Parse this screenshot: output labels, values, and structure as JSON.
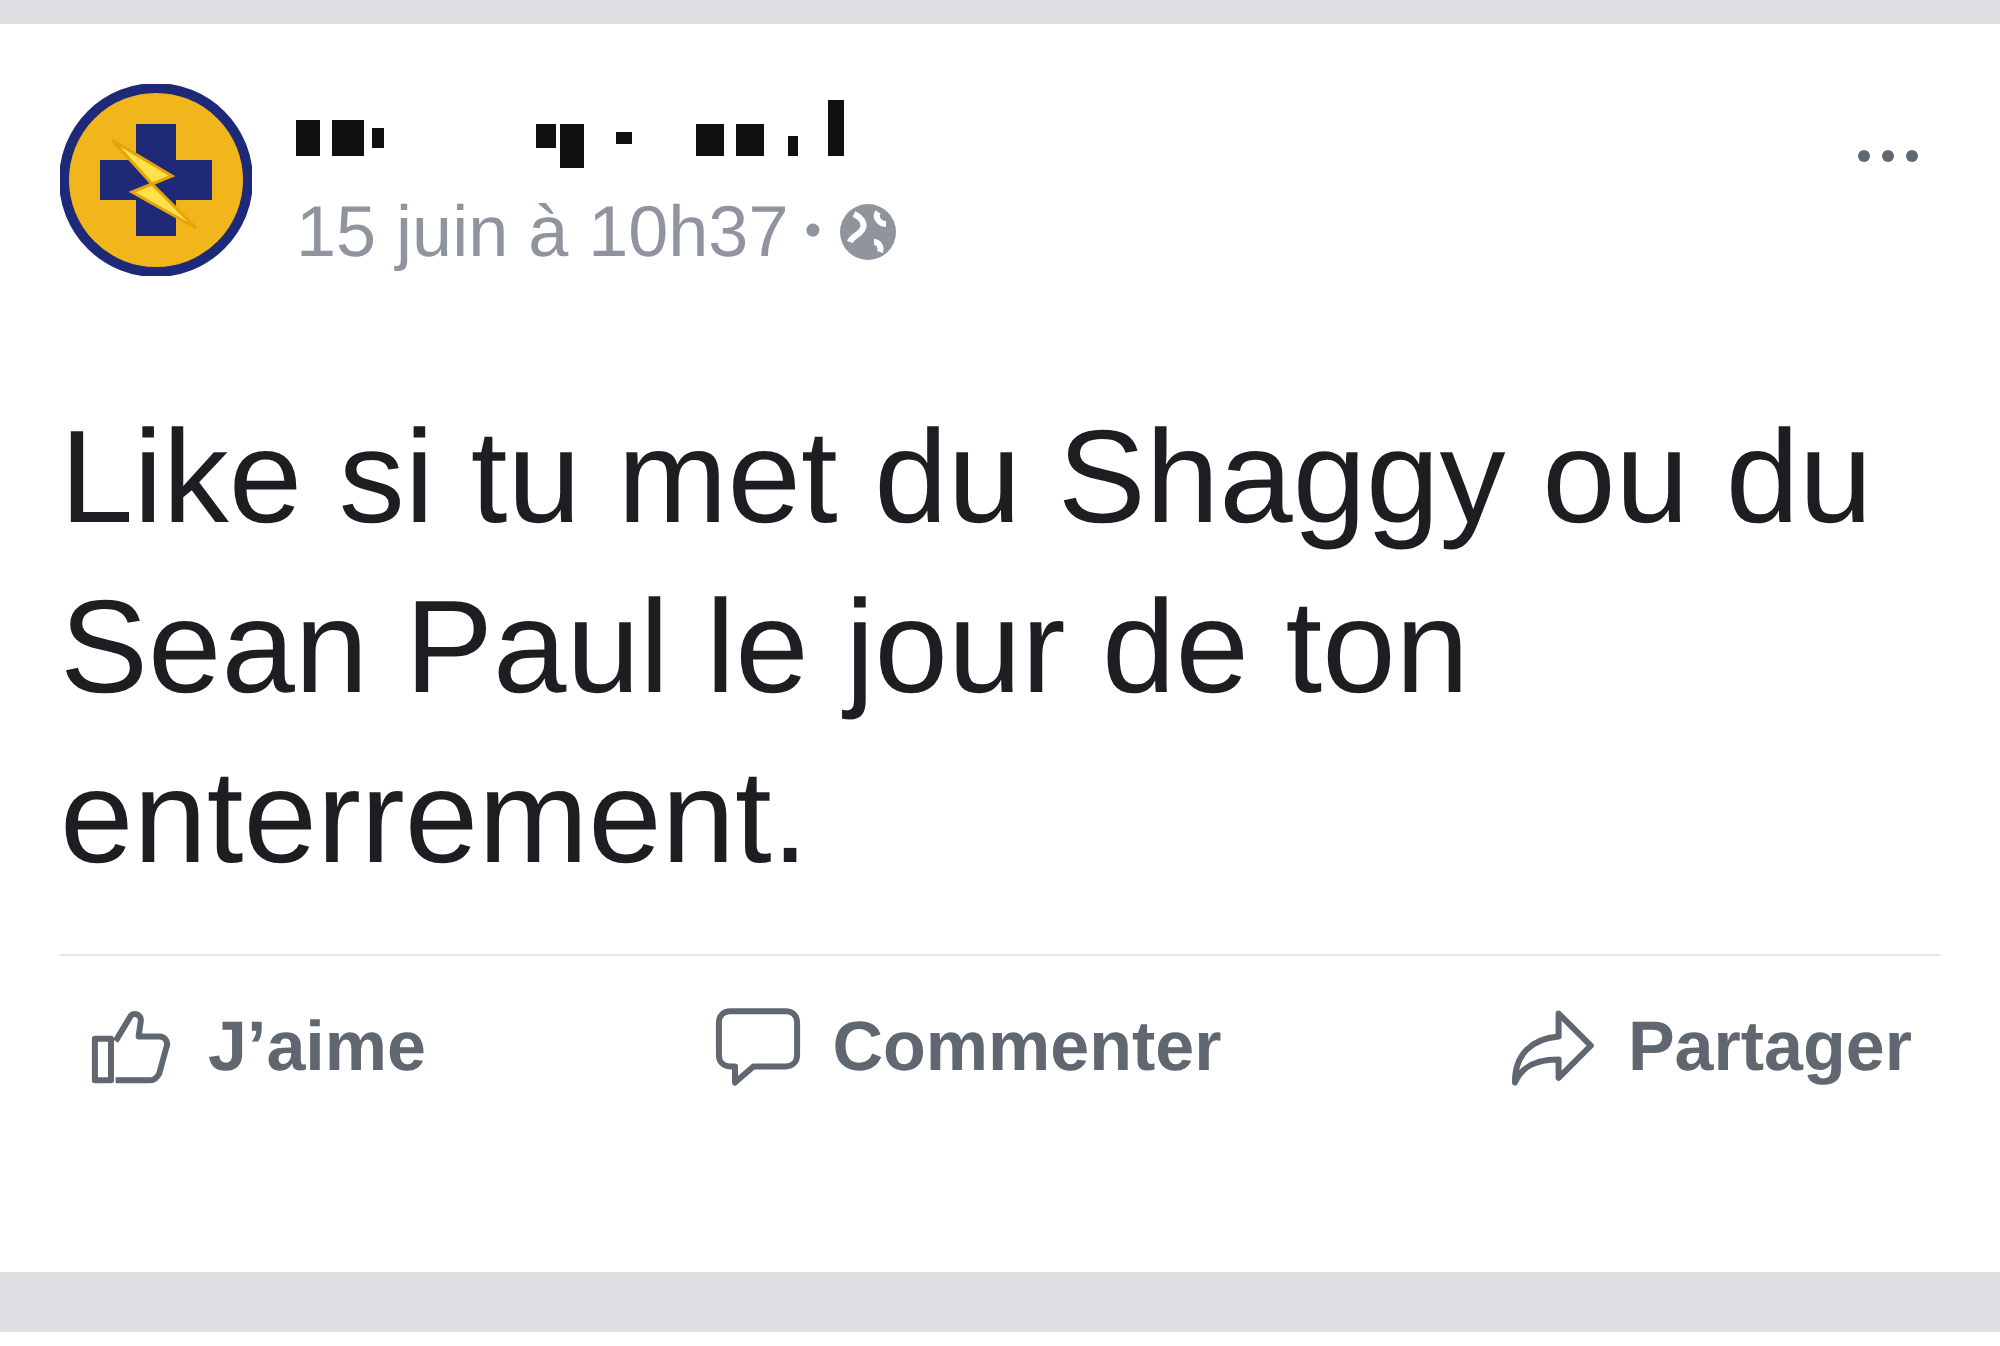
{
  "post": {
    "timestamp": "15 juin à 10h37",
    "separator": "•",
    "text": "Like si tu met du Shaggy ou du Sean Paul le jour de ton enterrement."
  },
  "actions": [
    {
      "kind": "like",
      "label": "J’aime"
    },
    {
      "kind": "comment",
      "label": "Commenter"
    },
    {
      "kind": "share",
      "label": "Partager"
    }
  ]
}
